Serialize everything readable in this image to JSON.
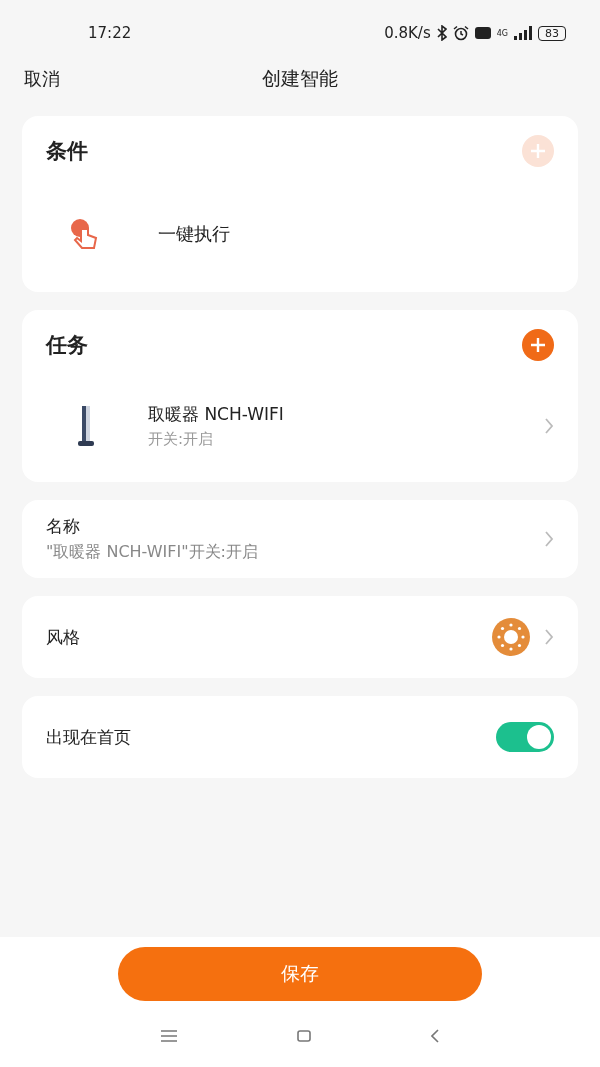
{
  "status_bar": {
    "time": "17:22",
    "net_speed": "0.8K/s",
    "network": "4G",
    "battery": "83"
  },
  "header": {
    "cancel": "取消",
    "title": "创建智能"
  },
  "condition": {
    "title": "条件",
    "add_button": {
      "disabled": true
    },
    "items": [
      {
        "label": "一键执行"
      }
    ]
  },
  "task": {
    "title": "任务",
    "add_button": {
      "disabled": false
    },
    "items": [
      {
        "name": "取暖器 NCH-WIFI",
        "status": "开关:开启"
      }
    ]
  },
  "name_row": {
    "label": "名称",
    "value": "\"取暖器 NCH-WIFI\"开关:开启"
  },
  "style_row": {
    "label": "风格"
  },
  "home_row": {
    "label": "出现在首页",
    "on": true
  },
  "save_button": {
    "label": "保存"
  }
}
